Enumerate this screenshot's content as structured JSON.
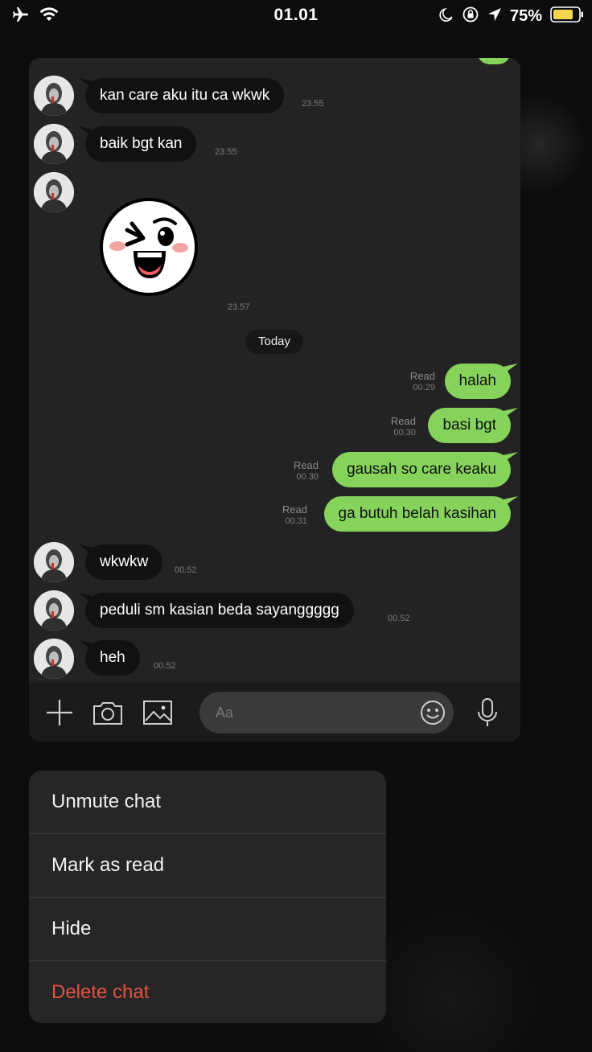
{
  "status_bar": {
    "time": "01.01",
    "battery_percent": "75%",
    "icons": [
      "airplane-icon",
      "wifi-icon",
      "moon-icon",
      "orientation-lock-icon",
      "location-arrow-icon",
      "battery-icon"
    ]
  },
  "chat": {
    "messages": [
      {
        "direction": "in",
        "text": "kan care aku itu ca wkwk",
        "time": "23.55"
      },
      {
        "direction": "in",
        "text": "baik bgt kan",
        "time": "23.55"
      },
      {
        "direction": "in",
        "type": "sticker",
        "sticker": "winking-laughing-face-sticker",
        "time": "23.57"
      },
      {
        "direction": "out",
        "text": "halah",
        "status": "Read",
        "time": "00.29"
      },
      {
        "direction": "out",
        "text": "basi bgt",
        "status": "Read",
        "time": "00.30"
      },
      {
        "direction": "out",
        "text": "gausah so care keaku",
        "status": "Read",
        "time": "00.30"
      },
      {
        "direction": "out",
        "text": "ga butuh belah kasihan",
        "status": "Read",
        "time": "00.31"
      },
      {
        "direction": "in",
        "text": "wkwkw",
        "time": "00.52"
      },
      {
        "direction": "in",
        "text": "peduli sm kasian beda sayanggggg",
        "time": "00.52"
      },
      {
        "direction": "in",
        "text": "heh",
        "time": "00.52"
      }
    ],
    "day_divider": "Today",
    "input": {
      "placeholder": "Aa"
    },
    "toolbar_icons": [
      "plus-icon",
      "camera-icon",
      "image-icon",
      "emoji-icon",
      "microphone-icon"
    ],
    "colors": {
      "outgoing": "#86d35c",
      "incoming": "#111111",
      "card": "#232323"
    }
  },
  "menu": {
    "items": [
      {
        "label": "Unmute chat"
      },
      {
        "label": "Mark as read"
      },
      {
        "label": "Hide"
      },
      {
        "label": "Delete chat",
        "destructive": true
      }
    ],
    "destructive_color": "#e2533f"
  }
}
